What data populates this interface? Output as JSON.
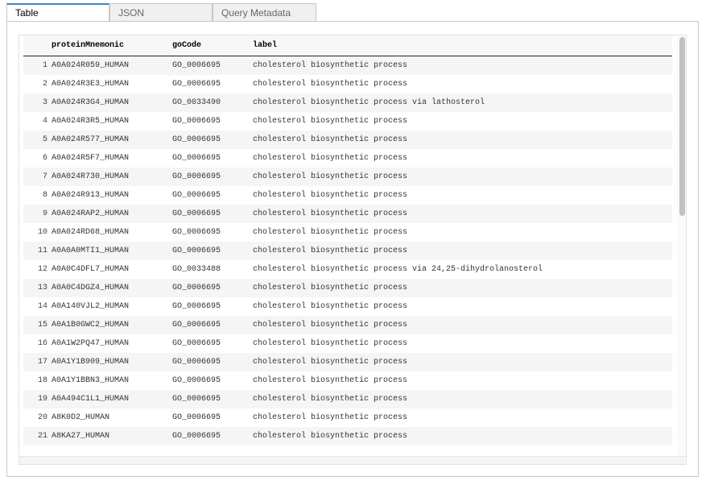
{
  "tabs": [
    {
      "label": "Table",
      "active": true
    },
    {
      "label": "JSON",
      "active": false
    },
    {
      "label": "Query Metadata",
      "active": false
    }
  ],
  "table": {
    "columns": [
      "proteinMnemonic",
      "goCode",
      "label"
    ],
    "rows": [
      {
        "index": "1",
        "proteinMnemonic": "A0A024R059_HUMAN",
        "goCode": "GO_0006695",
        "label": "cholesterol biosynthetic process"
      },
      {
        "index": "2",
        "proteinMnemonic": "A0A024R3E3_HUMAN",
        "goCode": "GO_0006695",
        "label": "cholesterol biosynthetic process"
      },
      {
        "index": "3",
        "proteinMnemonic": "A0A024R3G4_HUMAN",
        "goCode": "GO_0033490",
        "label": "cholesterol biosynthetic process via lathosterol"
      },
      {
        "index": "4",
        "proteinMnemonic": "A0A024R3R5_HUMAN",
        "goCode": "GO_0006695",
        "label": "cholesterol biosynthetic process"
      },
      {
        "index": "5",
        "proteinMnemonic": "A0A024R577_HUMAN",
        "goCode": "GO_0006695",
        "label": "cholesterol biosynthetic process"
      },
      {
        "index": "6",
        "proteinMnemonic": "A0A024R5F7_HUMAN",
        "goCode": "GO_0006695",
        "label": "cholesterol biosynthetic process"
      },
      {
        "index": "7",
        "proteinMnemonic": "A0A024R730_HUMAN",
        "goCode": "GO_0006695",
        "label": "cholesterol biosynthetic process"
      },
      {
        "index": "8",
        "proteinMnemonic": "A0A024R913_HUMAN",
        "goCode": "GO_0006695",
        "label": "cholesterol biosynthetic process"
      },
      {
        "index": "9",
        "proteinMnemonic": "A0A024RAP2_HUMAN",
        "goCode": "GO_0006695",
        "label": "cholesterol biosynthetic process"
      },
      {
        "index": "10",
        "proteinMnemonic": "A0A024RD68_HUMAN",
        "goCode": "GO_0006695",
        "label": "cholesterol biosynthetic process"
      },
      {
        "index": "11",
        "proteinMnemonic": "A0A0A0MTI1_HUMAN",
        "goCode": "GO_0006695",
        "label": "cholesterol biosynthetic process"
      },
      {
        "index": "12",
        "proteinMnemonic": "A0A0C4DFL7_HUMAN",
        "goCode": "GO_0033488",
        "label": "cholesterol biosynthetic process via 24,25-dihydrolanosterol"
      },
      {
        "index": "13",
        "proteinMnemonic": "A0A0C4DGZ4_HUMAN",
        "goCode": "GO_0006695",
        "label": "cholesterol biosynthetic process"
      },
      {
        "index": "14",
        "proteinMnemonic": "A0A140VJL2_HUMAN",
        "goCode": "GO_0006695",
        "label": "cholesterol biosynthetic process"
      },
      {
        "index": "15",
        "proteinMnemonic": "A0A1B0GWC2_HUMAN",
        "goCode": "GO_0006695",
        "label": "cholesterol biosynthetic process"
      },
      {
        "index": "16",
        "proteinMnemonic": "A0A1W2PQ47_HUMAN",
        "goCode": "GO_0006695",
        "label": "cholesterol biosynthetic process"
      },
      {
        "index": "17",
        "proteinMnemonic": "A0A1Y1B909_HUMAN",
        "goCode": "GO_0006695",
        "label": "cholesterol biosynthetic process"
      },
      {
        "index": "18",
        "proteinMnemonic": "A0A1Y1BBN3_HUMAN",
        "goCode": "GO_0006695",
        "label": "cholesterol biosynthetic process"
      },
      {
        "index": "19",
        "proteinMnemonic": "A0A494C1L1_HUMAN",
        "goCode": "GO_0006695",
        "label": "cholesterol biosynthetic process"
      },
      {
        "index": "20",
        "proteinMnemonic": "A8K0D2_HUMAN",
        "goCode": "GO_0006695",
        "label": "cholesterol biosynthetic process"
      },
      {
        "index": "21",
        "proteinMnemonic": "A8KA27_HUMAN",
        "goCode": "GO_0006695",
        "label": "cholesterol biosynthetic process"
      }
    ]
  },
  "colors": {
    "active_tab_accent": "#3f83c8",
    "row_stripe": "#f5f5f5"
  }
}
